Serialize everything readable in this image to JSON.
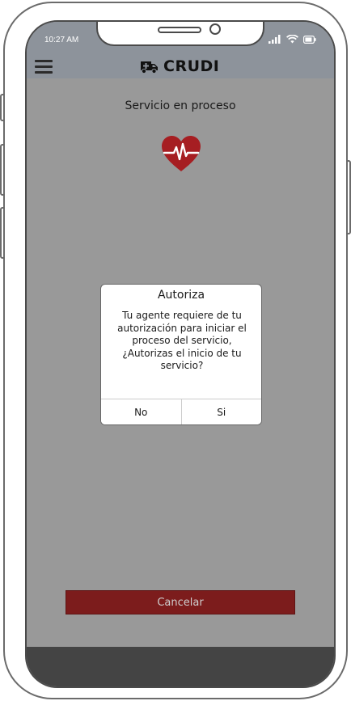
{
  "status_bar": {
    "time": "10:27 AM",
    "icons": [
      "signal-icon",
      "wifi-icon",
      "battery-icon"
    ]
  },
  "header": {
    "brand": "CRUDI",
    "menu_icon": "hamburger-menu-icon",
    "brand_icon": "ambulance-icon"
  },
  "main": {
    "title": "Servicio en proceso",
    "status_icon": "heartbeat-icon"
  },
  "dialog": {
    "title": "Autoriza",
    "message": "Tu agente requiere de tu autorización para iniciar el proceso del servicio, ¿Autorizas el inicio de tu servicio?",
    "no_label": "No",
    "yes_label": "Si"
  },
  "footer": {
    "cancel_label": "Cancelar"
  },
  "colors": {
    "accent": "#7c1c1c",
    "heart": "#a61e22",
    "header_bg": "#8d939b",
    "overlay_bg": "#999999"
  }
}
